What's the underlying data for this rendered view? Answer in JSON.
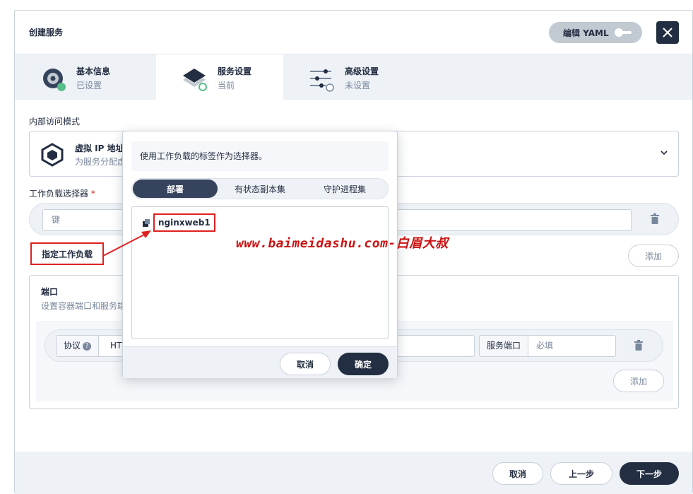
{
  "header": {
    "title": "创建服务",
    "yaml_label": "编辑 YAML"
  },
  "steps": [
    {
      "label": "基本信息",
      "status": "已设置"
    },
    {
      "label": "服务设置",
      "status": "当前"
    },
    {
      "label": "高级设置",
      "status": "未设置"
    }
  ],
  "access": {
    "section_label": "内部访问模式",
    "name": "虚拟 IP 地址",
    "desc": "为服务分配虚"
  },
  "selector": {
    "section_label": "工作负载选择器",
    "required_mark": "*",
    "key_placeholder": "键",
    "specify_button": "指定工作负载",
    "add_label": "添加"
  },
  "ports": {
    "title": "端口",
    "desc": "设置容器端口和服务端",
    "protocol_label": "协议",
    "protocol_value": "HTT",
    "service_port_label": "服务端口",
    "service_port_placeholder": "必填",
    "add_label": "添加"
  },
  "popover": {
    "tip": "使用工作负载的标签作为选择器。",
    "tabs": [
      "部署",
      "有状态副本集",
      "守护进程集"
    ],
    "active_tab": "部署",
    "items": [
      {
        "name": "nginxweb1"
      }
    ],
    "cancel_label": "取消",
    "confirm_label": "确定"
  },
  "footer": {
    "cancel": "取消",
    "prev": "上一步",
    "next": "下一步"
  },
  "watermark": "www.baimeidashu.com-白眉大叔",
  "colors": {
    "dark": "#242e42",
    "annotation": "#e02020",
    "success": "#55bc8a"
  }
}
